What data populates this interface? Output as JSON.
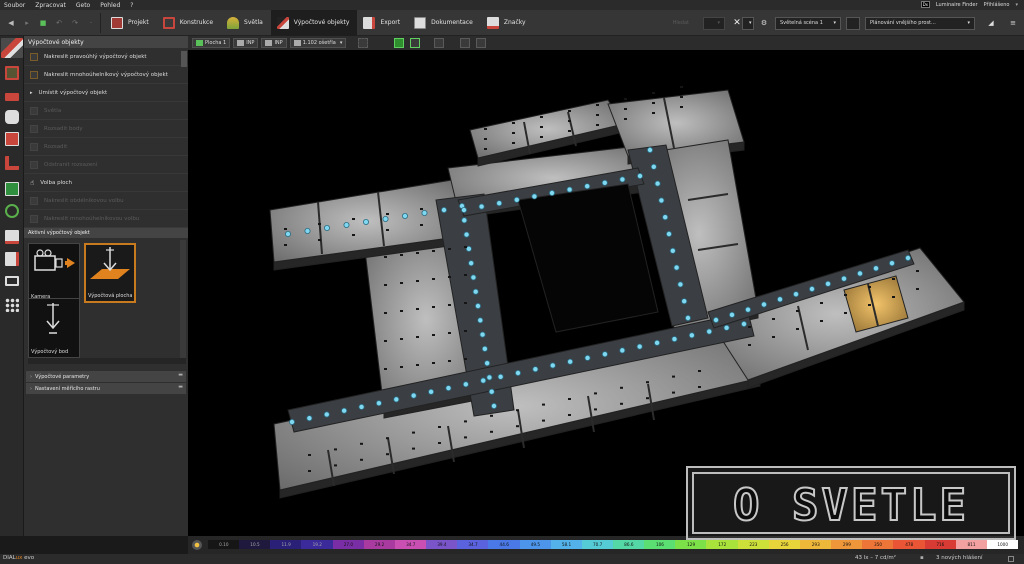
{
  "menu": {
    "items": [
      "Soubor",
      "Zpracovat",
      "Geto",
      "Pohled",
      "?"
    ],
    "luminaire_finder": "Luminaire Finder",
    "luminaire_finder_badge": "Dx",
    "login": "Přihlášeno"
  },
  "toolbar": {
    "tabs": [
      {
        "label": "Projekt",
        "icon": "project-icon",
        "color": "#c8463c"
      },
      {
        "label": "Konstrukce",
        "icon": "construction-icon",
        "color": "#c8463c"
      },
      {
        "label": "Světla",
        "icon": "lights-icon",
        "color": "#d8b23a"
      },
      {
        "label": "Výpočtové objekty",
        "icon": "calc-objects-icon",
        "color": "#8a8a8a",
        "active": true
      },
      {
        "label": "Export",
        "icon": "export-icon",
        "color": "#c8463c"
      },
      {
        "label": "Dokumentace",
        "icon": "documentation-icon",
        "color": "#9a9a9a"
      },
      {
        "label": "Značky",
        "icon": "marks-icon",
        "color": "#c8463c"
      }
    ],
    "scene_value": "Světelná scéna 1",
    "planning_value": "Plánování vnějšího prost...",
    "faded_value": "Hledat"
  },
  "panel": {
    "title": "Výpočtové objekty",
    "items": [
      {
        "label": "Nakreslit pravoúhlý výpočtový objekt",
        "enabled": true
      },
      {
        "label": "Nakreslit mnohoúhelníkový výpočtový objekt",
        "enabled": true
      },
      {
        "label": "Umístit výpočtový objekt",
        "enabled": true
      },
      {
        "label": "Světla",
        "enabled": false
      },
      {
        "label": "Rozsadit body",
        "enabled": false
      },
      {
        "label": "Rozsadit",
        "enabled": false
      },
      {
        "label": "Odstranit rozsazení",
        "enabled": false
      },
      {
        "label": "Volba ploch",
        "enabled": true
      },
      {
        "label": "Nakreslit obdélníkovou volbu",
        "enabled": false
      },
      {
        "label": "Nakreslit mnohoúhelníkovou volbu",
        "enabled": false
      }
    ],
    "active_title": "Aktivní výpočtový objekt",
    "objects": [
      {
        "label": "Kamera",
        "icon": "camera-icon"
      },
      {
        "label": "Výpočtová plocha",
        "icon": "calc-plane-icon",
        "selected": true
      },
      {
        "label": "Výpočtový bod",
        "icon": "calc-point-icon"
      }
    ],
    "sections": [
      "Výpočtové parametry",
      "Nastavení měřícího rastru"
    ]
  },
  "viewport_toolbar": {
    "plane": "Plocha 1",
    "inp1": "INP",
    "inp2": "INP",
    "floor": "1.102 ošetřla"
  },
  "legend": {
    "colors": [
      "#161616",
      "#1f1a3d",
      "#2a2078",
      "#3b2a9a",
      "#7a2ea5",
      "#a83aa0",
      "#c94fb3",
      "#7a55c9",
      "#5b62dd",
      "#4a78e6",
      "#4c95ea",
      "#53b2ea",
      "#55cbd5",
      "#54d8a6",
      "#5bde72",
      "#7ce048",
      "#a8e23a",
      "#cde03a",
      "#e7d33a",
      "#edb73a",
      "#ef963a",
      "#ee7538",
      "#ea5535",
      "#d83a34",
      "#f2a0a0",
      "#ffffff"
    ],
    "labels": [
      "0.10",
      "10.5",
      "11.9",
      "19.2",
      "27.0",
      "29.2",
      "34.7",
      "39.4",
      "34.7",
      "44.6",
      "49.5",
      "58.1",
      "70.7",
      "86.6",
      "106",
      "129",
      "172",
      "223",
      "256",
      "293",
      "299",
      "350",
      "478",
      "716",
      "811",
      "1000"
    ]
  },
  "status": {
    "brand_dial": "DIAL",
    "brand_lux": "ux",
    "brand_evo": " evo",
    "range": "43 lx – 7 cd/m²",
    "messages": "3 nových hlášení"
  },
  "watermark": {
    "text": "O SVETLE"
  }
}
